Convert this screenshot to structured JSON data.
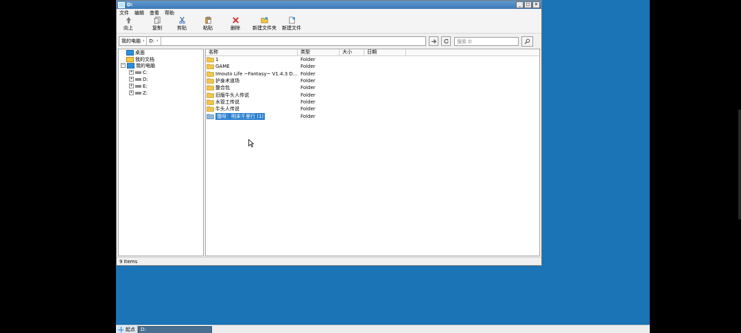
{
  "window": {
    "title": "D:"
  },
  "menu": [
    "文件",
    "编辑",
    "查看",
    "帮助"
  ],
  "toolbar": [
    {
      "label": "向上",
      "icon": "up-arrow-icon"
    },
    {
      "label": "复制",
      "icon": "copy-icon"
    },
    {
      "label": "剪贴",
      "icon": "cut-icon"
    },
    {
      "label": "粘贴",
      "icon": "paste-icon"
    },
    {
      "label": "删除",
      "icon": "delete-icon"
    },
    {
      "label": "新建文件夹",
      "icon": "new-folder-icon"
    },
    {
      "label": "新建文件",
      "icon": "new-file-icon"
    }
  ],
  "address": {
    "crumbs": [
      "我的电脑",
      "D:"
    ],
    "search_placeholder": "搜索 D"
  },
  "tree": {
    "desktop": "桌面",
    "documents": "我的文档",
    "computer": "我的电脑",
    "drives": [
      "C:",
      "D:",
      "E:",
      "Z:"
    ]
  },
  "list": {
    "columns": [
      "名称",
      "类型",
      "大小",
      "日期"
    ],
    "rows": [
      {
        "name": "1",
        "type": "Folder"
      },
      {
        "name": "GAME",
        "type": "Folder"
      },
      {
        "name": "Imouto Life ~Fantasy~ V1.4.3 D...",
        "type": "Folder"
      },
      {
        "name": "护身术道场",
        "type": "Folder"
      },
      {
        "name": "整合包",
        "type": "Folder"
      },
      {
        "name": "旧版牛头人传说",
        "type": "Folder"
      },
      {
        "name": "水管工传说",
        "type": "Folder"
      },
      {
        "name": "牛头人传说",
        "type": "Folder"
      },
      {
        "name": "饿呀：明末千里行 (1)",
        "type": "Folder",
        "selected": true
      }
    ]
  },
  "status": "9 Items",
  "taskbar": {
    "start_label": "起点",
    "task_label": "D:"
  },
  "colors": {
    "desktop": "#1a74b5",
    "selection": "#2a7fd0",
    "folder": "#f3c64a"
  }
}
